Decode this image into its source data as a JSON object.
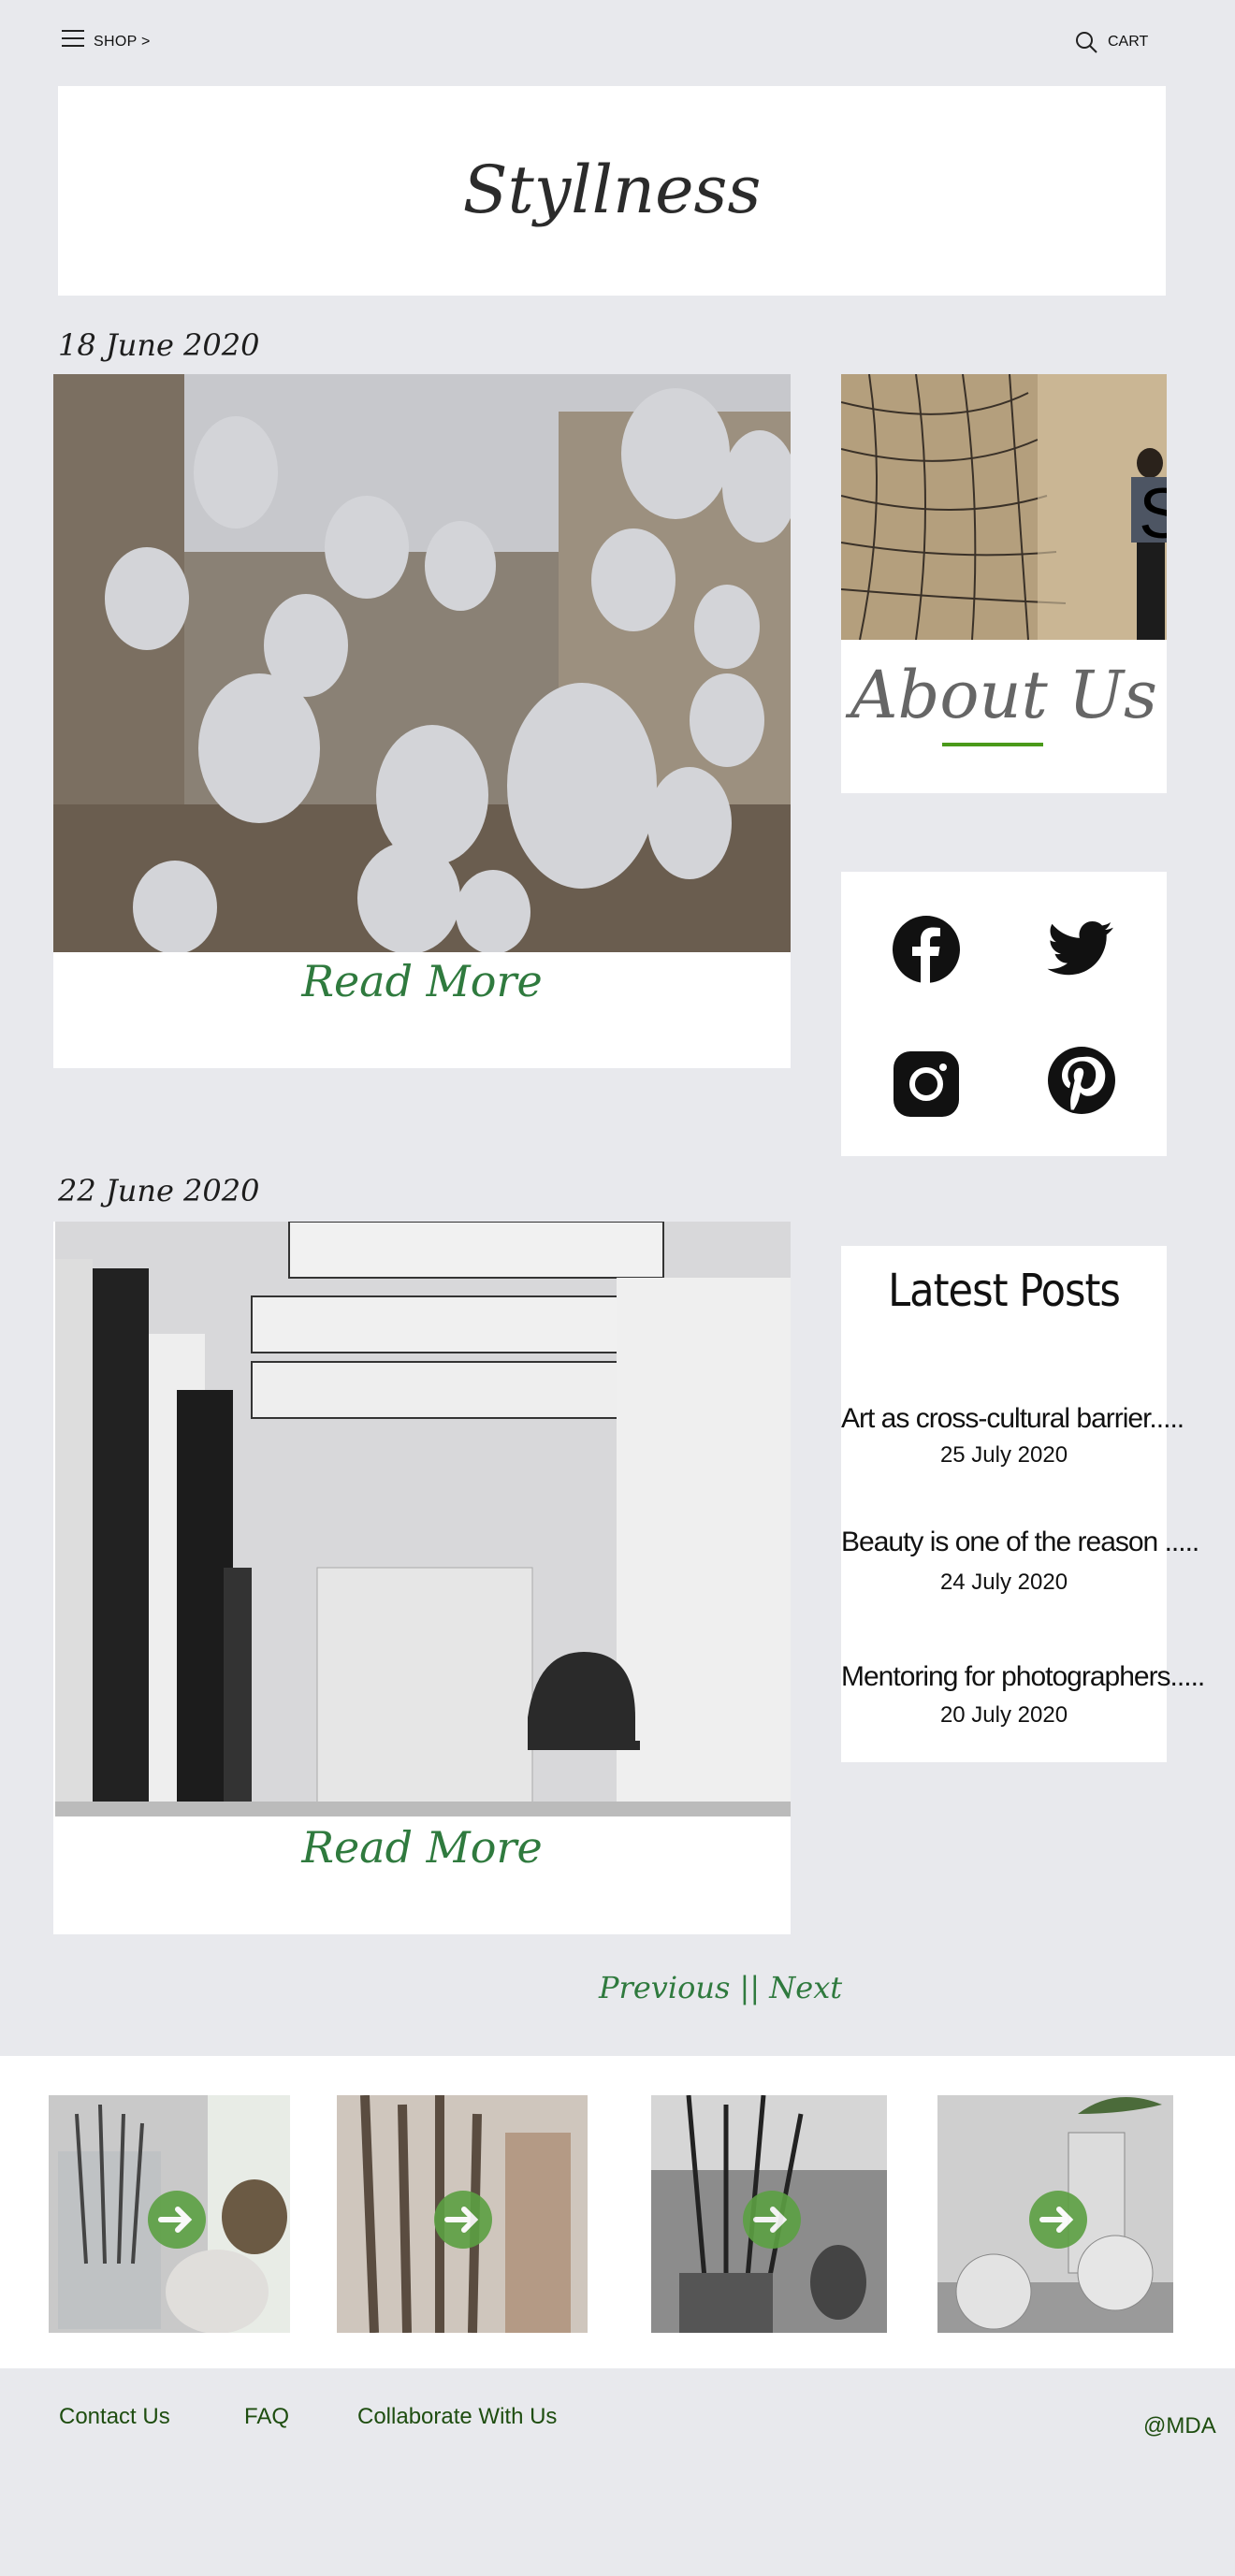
{
  "topbar": {
    "shop_label": "SHOP >",
    "cart_label": "CART"
  },
  "header": {
    "brand": "Styllness"
  },
  "posts": [
    {
      "date": "18 June 2020",
      "read_more": "Read More"
    },
    {
      "date": "22 June 2020",
      "read_more": "Read More"
    }
  ],
  "pagination": {
    "label": "Previous || Next"
  },
  "sidebar": {
    "about": {
      "title": "About Us",
      "overlay_letter": "S"
    },
    "social": [
      "facebook-icon",
      "twitter-icon",
      "instagram-icon",
      "pinterest-icon"
    ],
    "latest": {
      "title": "Latest Posts",
      "items": [
        {
          "title": "Art as cross-cultural barrier.....",
          "date": "25 July 2020"
        },
        {
          "title": "Beauty is one of the reason .....",
          "date": "24 July 2020"
        },
        {
          "title": "Mentoring for photographers.....",
          "date": "20 July 2020"
        }
      ]
    }
  },
  "gallery": {
    "arrow_icon": "arrow-right-icon",
    "accent": "#5ca043"
  },
  "footer": {
    "links": [
      "Contact Us",
      "FAQ",
      "Collaborate With Us"
    ],
    "credit": "@MDA"
  },
  "colors": {
    "background": "#e8e9ed",
    "accent_green": "#2f7a3e",
    "about_line": "#4a9a1a"
  }
}
